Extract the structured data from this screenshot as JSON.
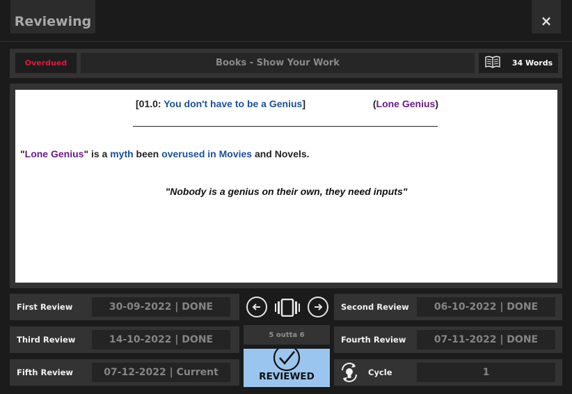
{
  "header": {
    "title": "Reviewing",
    "close_label": "×"
  },
  "top_bar": {
    "status_badge": "Overdued",
    "deck_name": "Books - Show Your Work",
    "word_count": "34 Words",
    "word_count_icon": "open-book-icon"
  },
  "card": {
    "heading_open": "[01.0: ",
    "heading_title": "You don't have to be a Genius",
    "heading_close": "]",
    "tag_open": "(",
    "tag": "Lone Genius",
    "tag_close": ")",
    "body": {
      "quote_open": "\"",
      "term": "Lone Genius",
      "quote_close": "\"",
      "t1": " is a ",
      "w1": "myth",
      "t2": " been ",
      "w2": "overused in Movies",
      "t3": " and Novels."
    },
    "quote": "\"Nobody is a genius on their own, they need inputs\""
  },
  "reviews": {
    "first": {
      "label": "First Review",
      "value": "30-09-2022 | DONE"
    },
    "second": {
      "label": "Second Review",
      "value": "06-10-2022 | DONE"
    },
    "third": {
      "label": "Third Review",
      "value": "14-10-2022 | DONE"
    },
    "fourth": {
      "label": "Fourth Review",
      "value": "07-11-2022 | DONE"
    },
    "fifth": {
      "label": "Fifth Review",
      "value": "07-12-2022 | Current"
    }
  },
  "controls": {
    "prev_icon": "arrow-left-circle-icon",
    "next_icon": "arrow-right-circle-icon",
    "cards_icon": "card-carousel-icon",
    "progress": "5 outta 6",
    "reviewed_label": "REVIEWED",
    "reviewed_icon": "check-circle-icon"
  },
  "cycle": {
    "label": "Cycle",
    "value": "1",
    "icon": "cycle-bulb-icon"
  },
  "colors": {
    "overdue": "#e0183c",
    "link_blue": "#1a4f98",
    "tag_purple": "#6a1a8a",
    "reviewed_bg": "#9ac5ee"
  }
}
